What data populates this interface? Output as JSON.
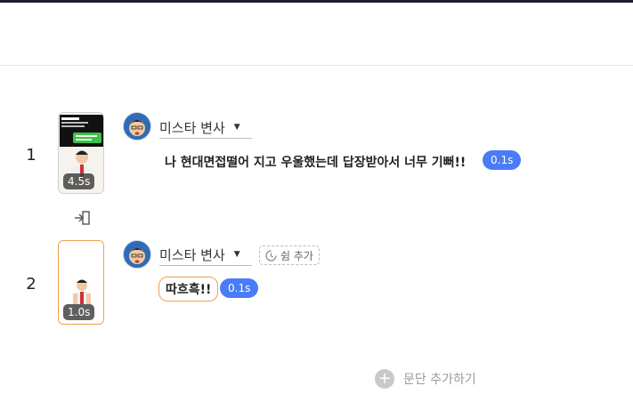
{
  "scenes": [
    {
      "number": "1",
      "duration": "4.5s",
      "speaker": "미스타 변사",
      "text": "나 현대면접떨어 지고 우울했는데 답장받아서 너무 기뻐!!",
      "pause": "0.1s"
    },
    {
      "number": "2",
      "duration": "1.0s",
      "speaker": "미스타 변사",
      "rest_button": "쉼 추가",
      "text": "따흐흑!!",
      "pause": "0.1s"
    }
  ],
  "add_paragraph_label": "문단 추가하기",
  "colors": {
    "accent_blue": "#4a7cf7",
    "selection_orange": "#f0a04b",
    "top_bar": "#1c1f2e"
  },
  "icons": [
    "split-icon",
    "clock-icon",
    "plus-icon",
    "caret-down-icon"
  ]
}
